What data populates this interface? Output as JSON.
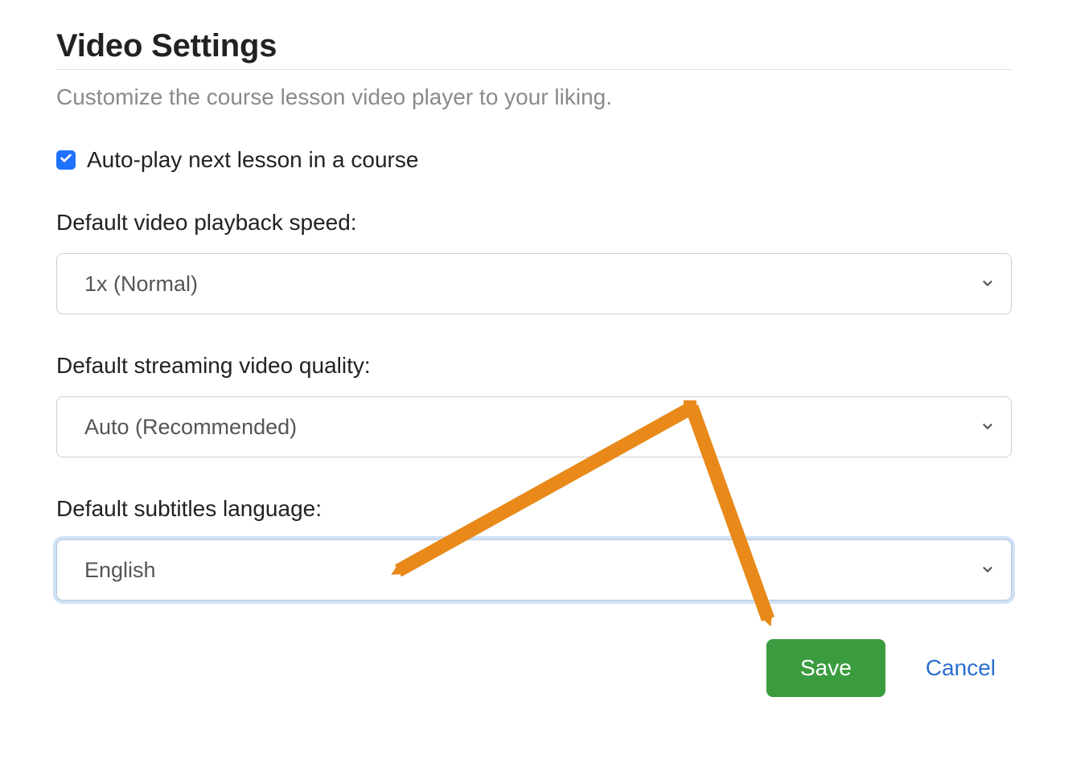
{
  "header": {
    "title": "Video Settings",
    "subtitle": "Customize the course lesson video player to your liking."
  },
  "autoplay": {
    "label": "Auto-play next lesson in a course",
    "checked": true
  },
  "playback_speed": {
    "label": "Default video playback speed:",
    "value": "1x (Normal)"
  },
  "video_quality": {
    "label": "Default streaming video quality:",
    "value": "Auto (Recommended)"
  },
  "subtitles_language": {
    "label": "Default subtitles language:",
    "value": "English"
  },
  "buttons": {
    "save": "Save",
    "cancel": "Cancel"
  },
  "annotation": {
    "color": "#e8891a"
  }
}
